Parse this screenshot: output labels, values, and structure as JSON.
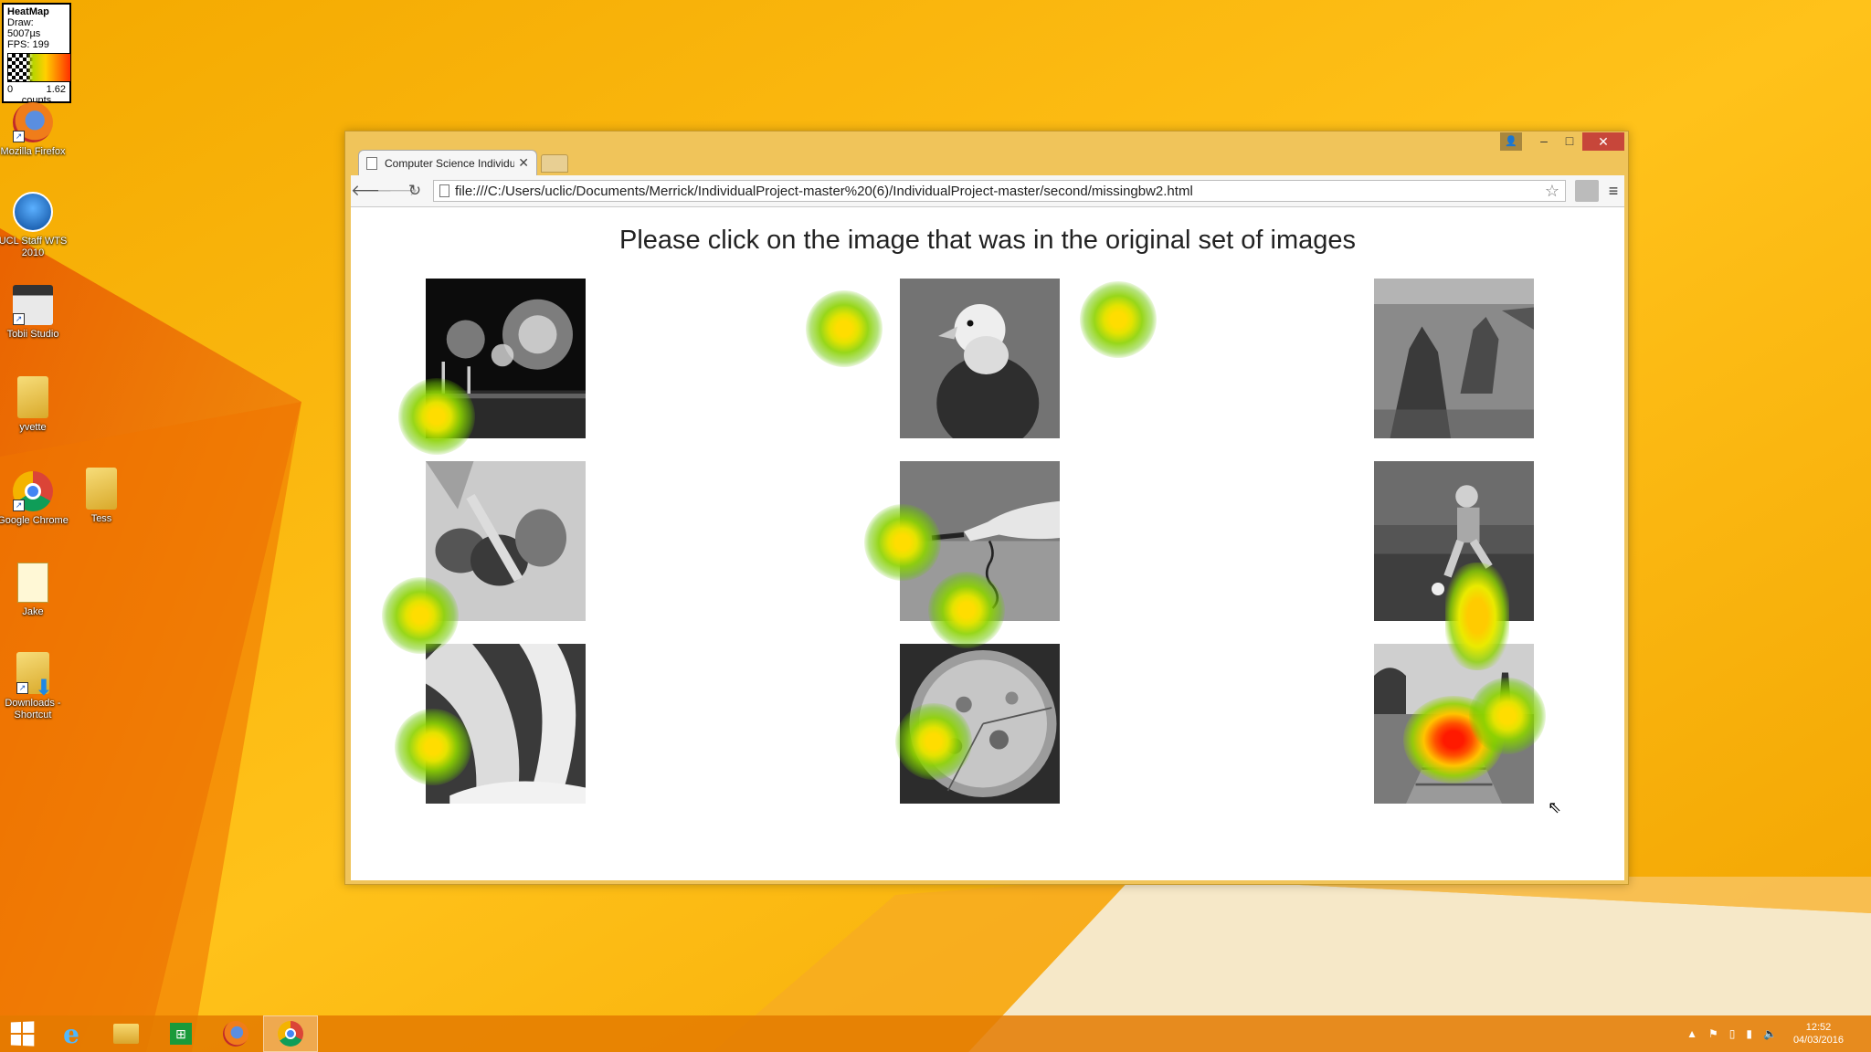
{
  "heatmap_legend": {
    "title": "HeatMap",
    "draw": "Draw: 5007µs",
    "fps": "FPS: 199",
    "min": "0",
    "max": "1.62",
    "units": "counts"
  },
  "desktop_icons": [
    {
      "label": "Mozilla Firefox",
      "icon": "firefox"
    },
    {
      "label": "UCL Staff WTS 2010",
      "icon": "ucl-remote"
    },
    {
      "label": "Tobii Studio",
      "icon": "tobii"
    },
    {
      "label": "yvette",
      "icon": "folder"
    },
    {
      "label": "Google Chrome",
      "icon": "chrome"
    },
    {
      "label": "Tess",
      "icon": "folder"
    },
    {
      "label": "Jake",
      "icon": "document"
    },
    {
      "label": "Downloads - Shortcut",
      "icon": "downloads-folder"
    }
  ],
  "browser": {
    "tab_title": "Computer Science Individu",
    "url": "file:///C:/Users/uclic/Documents/Merrick/IndividualProject-master%20(6)/IndividualProject-master/second/missingbw2.html",
    "window_controls": {
      "minimize": "–",
      "maximize": "□",
      "close": "✕"
    }
  },
  "page": {
    "heading": "Please click on the image that was in the original set of images",
    "images": [
      {
        "name": "fireworks"
      },
      {
        "name": "eagle"
      },
      {
        "name": "sea-stacks"
      },
      {
        "name": "chopping-peppers"
      },
      {
        "name": "hand-with-cable"
      },
      {
        "name": "football-player"
      },
      {
        "name": "measuring-tape"
      },
      {
        "name": "pizza"
      },
      {
        "name": "stairway-street"
      }
    ]
  },
  "taskbar": {
    "items": [
      "start",
      "internet-explorer",
      "file-explorer",
      "store",
      "firefox",
      "chrome"
    ],
    "active": "chrome"
  },
  "clock": {
    "time": "12:52",
    "date": "04/03/2016"
  },
  "colors": {
    "wallpaper": "#f7b400",
    "taskbar": "#e47a00",
    "window_frame": "#f0c45a",
    "close_button": "#c7463a"
  }
}
